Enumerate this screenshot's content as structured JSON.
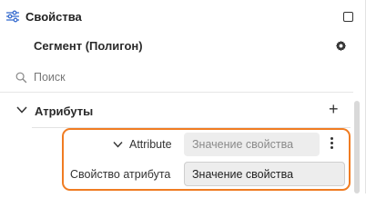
{
  "header": {
    "title": "Свойства"
  },
  "segment": {
    "title": "Сегмент (Полигон)"
  },
  "search": {
    "placeholder": "Поиск"
  },
  "section": {
    "label": "Атрибуты"
  },
  "attributes": [
    {
      "label": "Attribute",
      "value": "Значение свойства",
      "value_is_placeholder": true
    },
    {
      "label": "Свойство атрибута",
      "value": "Значение свойства",
      "value_is_placeholder": false
    }
  ],
  "colors": {
    "highlight": "#f07c22",
    "field_bg": "#ededed"
  },
  "icons": [
    "sliders-icon",
    "square-icon",
    "gear-icon",
    "search-icon",
    "chevron-down-icon",
    "plus-icon",
    "kebab-icon"
  ]
}
